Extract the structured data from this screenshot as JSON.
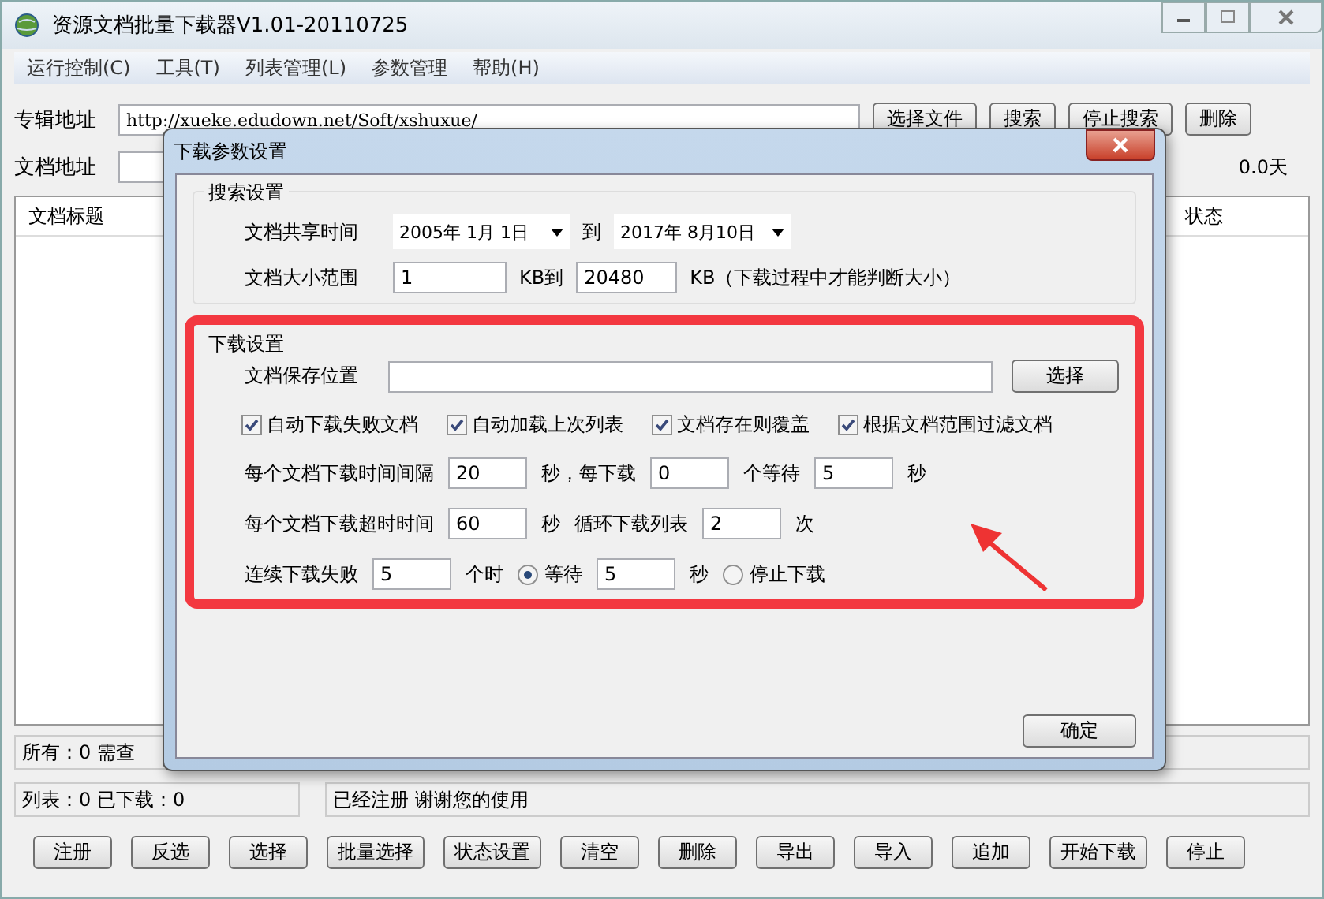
{
  "window": {
    "title": "资源文档批量下载器V1.01-20110725"
  },
  "menu": [
    "运行控制(C)",
    "工具(T)",
    "列表管理(L)",
    "参数管理",
    "帮助(H)"
  ],
  "album_address": {
    "label": "专辑地址",
    "value": "http://xueke.edudown.net/Soft/xshuxue/"
  },
  "top_buttons": [
    "选择文件",
    "搜索",
    "停止搜索",
    "删除"
  ],
  "doc_address": {
    "label": "文档地址",
    "duration": "0.0天"
  },
  "list": {
    "columns": [
      "文档标题",
      "状态"
    ]
  },
  "status": {
    "all": "所有：0 需查",
    "counts": "列表：0 已下载：0",
    "message": "已经注册 谢谢您的使用"
  },
  "bottom_buttons": [
    "注册",
    "反选",
    "选择",
    "批量选择",
    "状态设置",
    "清空",
    "删除",
    "导出",
    "导入",
    "追加",
    "开始下载",
    "停止"
  ],
  "dialog": {
    "title": "下载参数设置",
    "search_group": {
      "title": "搜索设置",
      "share_time": {
        "label": "文档共享时间",
        "from": "2005年 1月 1日",
        "to_label": "到",
        "to": "2017年 8月10日"
      },
      "size_range": {
        "label": "文档大小范围",
        "min": "1",
        "mid_label": "KB到",
        "max": "20480",
        "note": "KB（下载过程中才能判断大小）"
      }
    },
    "download_group": {
      "title": "下载设置",
      "highlighted": true,
      "save_location": {
        "label": "文档保存位置",
        "button": "选择"
      },
      "options": [
        {
          "label": "自动下载失败文档",
          "checked": true
        },
        {
          "label": "自动加载上次列表",
          "checked": true
        },
        {
          "label": "文档存在则覆盖",
          "checked": true
        },
        {
          "label": "根据文档范围过滤文档",
          "checked": true
        }
      ],
      "rows": [
        {
          "items": [
            {
              "kind": "text",
              "text": "每个文档下载时间间隔"
            },
            {
              "kind": "field",
              "value": "20"
            },
            {
              "kind": "text",
              "text": "秒，每下载"
            },
            {
              "kind": "field",
              "value": "0"
            },
            {
              "kind": "text",
              "text": "个等待"
            },
            {
              "kind": "field",
              "value": "5"
            },
            {
              "kind": "text",
              "text": "秒"
            }
          ]
        },
        {
          "items": [
            {
              "kind": "text",
              "text": "每个文档下载超时时间"
            },
            {
              "kind": "field",
              "value": "60"
            },
            {
              "kind": "text",
              "text": "秒"
            },
            {
              "kind": "text",
              "text": "循环下载列表"
            },
            {
              "kind": "field",
              "value": "2"
            },
            {
              "kind": "text",
              "text": "次"
            }
          ]
        },
        {
          "items": [
            {
              "kind": "text",
              "text": "连续下载失败"
            },
            {
              "kind": "field",
              "value": "5"
            },
            {
              "kind": "text",
              "text": "个时"
            },
            {
              "kind": "radio",
              "text": "等待",
              "selected": true
            },
            {
              "kind": "field",
              "value": "5"
            },
            {
              "kind": "text",
              "text": "秒"
            },
            {
              "kind": "radio",
              "text": "停止下载",
              "selected": false
            }
          ]
        }
      ]
    },
    "ok_button": "确定"
  }
}
